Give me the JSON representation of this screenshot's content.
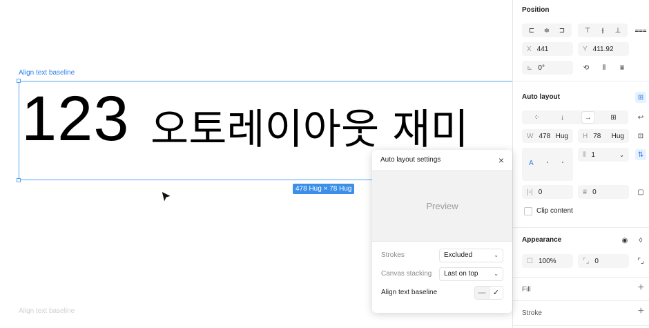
{
  "canvas": {
    "frame_label": "Align text baseline",
    "number_text": "123",
    "korean_text": "오토레이아웃 재미",
    "size_tag": "478 Hug × 78 Hug",
    "ghost_label": "Align text baseline"
  },
  "popup": {
    "title": "Auto layout settings",
    "close_icon": "×",
    "preview": "Preview",
    "strokes_label": "Strokes",
    "strokes_value": "Excluded",
    "stacking_label": "Canvas stacking",
    "stacking_value": "Last on top",
    "baseline_label": "Align text baseline",
    "baseline_off": "—",
    "baseline_on": "✓"
  },
  "panel": {
    "position_title": "Position",
    "x_label": "X",
    "x_value": "441",
    "y_label": "Y",
    "y_value": "411.92",
    "rotation_label": "⊾",
    "rotation_value": "0°",
    "auto_layout_title": "Auto layout",
    "w_label": "W",
    "w_value": "478",
    "w_mode": "Hug",
    "h_label": "H",
    "h_value": "78",
    "h_mode": "Hug",
    "gap_value": "1",
    "pad_h_value": "0",
    "pad_v_value": "0",
    "align_letter": "A",
    "clip_label": "Clip content",
    "appearance_title": "Appearance",
    "opacity_value": "100%",
    "radius_value": "0",
    "fill_title": "Fill",
    "stroke_title": "Stroke"
  },
  "icons": [
    "align-left-icon",
    "align-center-icon",
    "align-right-icon",
    "align-top-icon",
    "align-middle-icon",
    "align-bottom-icon",
    "distribute-icon",
    "rotate-icon",
    "flip-horizontal-icon",
    "flip-vertical-icon",
    "auto-layout-toggle-icon",
    "eye-icon",
    "drop-icon",
    "plus-icon",
    "close-icon",
    "cursor-icon"
  ]
}
